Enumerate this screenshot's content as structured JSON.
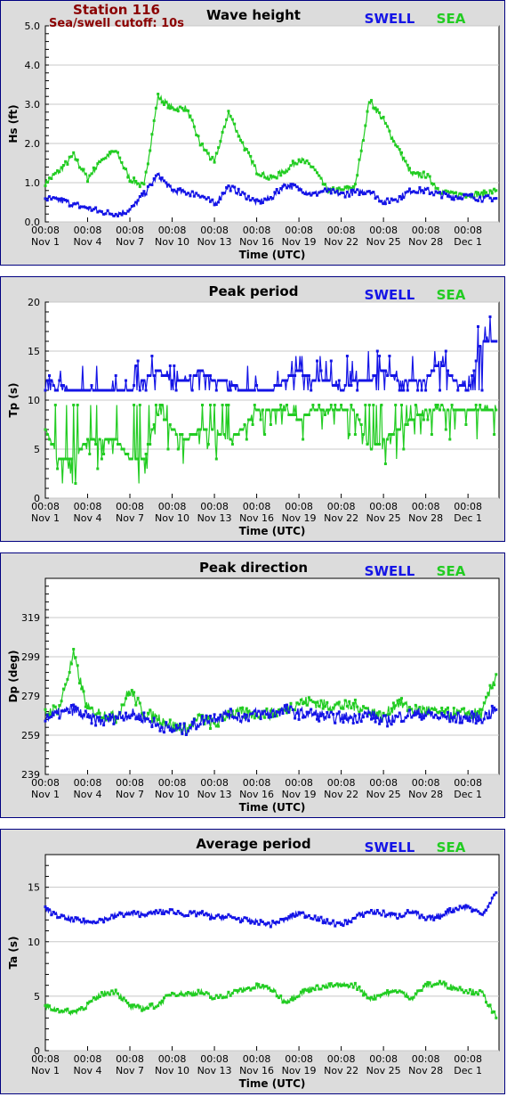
{
  "header": {
    "station": "Station 116",
    "cutoff": "Sea/swell cutoff: 10s"
  },
  "legend": {
    "swell": "SWELL",
    "sea": "SEA"
  },
  "colors": {
    "swell": "#1414e6",
    "sea": "#22cc22",
    "border": "#000080",
    "panel_bg": "#dcdcdc",
    "station_text": "#8b0000"
  },
  "xaxis": {
    "label": "Time (UTC)",
    "range": [
      0,
      32.2
    ],
    "ticks": [
      {
        "pos": 0,
        "time": "00:08",
        "date": "Nov 1"
      },
      {
        "pos": 3,
        "time": "00:08",
        "date": "Nov 4"
      },
      {
        "pos": 6,
        "time": "00:08",
        "date": "Nov 7"
      },
      {
        "pos": 9,
        "time": "00:08",
        "date": "Nov 10"
      },
      {
        "pos": 12,
        "time": "00:08",
        "date": "Nov 13"
      },
      {
        "pos": 15,
        "time": "00:08",
        "date": "Nov 16"
      },
      {
        "pos": 18,
        "time": "00:08",
        "date": "Nov 19"
      },
      {
        "pos": 21,
        "time": "00:08",
        "date": "Nov 22"
      },
      {
        "pos": 24,
        "time": "00:08",
        "date": "Nov 25"
      },
      {
        "pos": 27,
        "time": "00:08",
        "date": "Nov 28"
      },
      {
        "pos": 30,
        "time": "00:08",
        "date": "Dec 1"
      }
    ]
  },
  "chart_data": [
    {
      "type": "line",
      "title": "Wave height",
      "ylabel": "Hs (ft)",
      "ylim": [
        0,
        5
      ],
      "yticks": [
        "0.0",
        "1.0",
        "2.0",
        "3.0",
        "4.0",
        "5.0"
      ],
      "ytick_values": [
        0,
        1,
        2,
        3,
        4,
        5
      ],
      "x": [
        0,
        1,
        2,
        3,
        4,
        5,
        6,
        7,
        8,
        9,
        10,
        11,
        12,
        13,
        14,
        15,
        16,
        17,
        18,
        19,
        20,
        21,
        22,
        23,
        24,
        25,
        26,
        27,
        28,
        29,
        30,
        31,
        32
      ],
      "series": [
        {
          "name": "SWELL",
          "values": [
            0.6,
            0.55,
            0.45,
            0.35,
            0.25,
            0.2,
            0.3,
            0.7,
            1.2,
            0.8,
            0.75,
            0.7,
            0.45,
            0.9,
            0.7,
            0.5,
            0.6,
            0.95,
            0.85,
            0.7,
            0.8,
            0.7,
            0.75,
            0.8,
            0.5,
            0.6,
            0.8,
            0.8,
            0.7,
            0.65,
            0.65,
            0.6,
            0.6
          ]
        },
        {
          "name": "SEA",
          "values": [
            1.0,
            1.3,
            1.7,
            1.1,
            1.6,
            1.8,
            1.1,
            0.9,
            3.2,
            2.9,
            2.9,
            2.0,
            1.5,
            2.8,
            2.0,
            1.3,
            1.1,
            1.3,
            1.6,
            1.4,
            0.8,
            0.8,
            0.9,
            3.1,
            2.6,
            1.9,
            1.2,
            1.2,
            0.8,
            0.7,
            0.7,
            0.7,
            0.8
          ]
        }
      ]
    },
    {
      "type": "line",
      "title": "Peak period",
      "ylabel": "Tp (s)",
      "ylim": [
        0,
        20
      ],
      "yticks": [
        "0",
        "5",
        "10",
        "15",
        "20"
      ],
      "ytick_values": [
        0,
        5,
        10,
        15,
        20
      ],
      "x": [
        0,
        1,
        2,
        3,
        4,
        5,
        6,
        7,
        8,
        9,
        10,
        11,
        12,
        13,
        14,
        15,
        16,
        17,
        18,
        19,
        20,
        21,
        22,
        23,
        24,
        25,
        26,
        27,
        28,
        29,
        30,
        31,
        32
      ],
      "series": [
        {
          "name": "SWELL",
          "values": [
            12,
            11.5,
            11,
            11,
            11,
            11,
            11,
            12,
            13,
            12,
            12,
            13,
            12,
            12,
            11,
            11,
            11,
            12,
            13,
            12,
            12,
            11,
            12,
            12,
            13,
            12,
            12,
            12,
            14,
            12,
            11,
            16,
            16
          ]
        },
        {
          "name": "SEA",
          "values": [
            7,
            4,
            4,
            6,
            6,
            6,
            4,
            4,
            9,
            7,
            6,
            7,
            7,
            6,
            7,
            9,
            9,
            9,
            8,
            9,
            9,
            9,
            9,
            5,
            6,
            7,
            8,
            9,
            9,
            9,
            9,
            9,
            9
          ]
        }
      ]
    },
    {
      "type": "line",
      "title": "Peak direction",
      "ylabel": "Dp (deg)",
      "ylim": [
        239,
        339
      ],
      "yticks": [
        "239",
        "259",
        "279",
        "299",
        "319"
      ],
      "ytick_values": [
        239,
        259,
        279,
        299,
        319
      ],
      "x": [
        0,
        1,
        2,
        3,
        4,
        5,
        6,
        7,
        8,
        9,
        10,
        11,
        12,
        13,
        14,
        15,
        16,
        17,
        18,
        19,
        20,
        21,
        22,
        23,
        24,
        25,
        26,
        27,
        28,
        29,
        30,
        31,
        32
      ],
      "series": [
        {
          "name": "SWELL",
          "values": [
            268,
            270,
            272,
            268,
            266,
            268,
            270,
            268,
            264,
            262,
            262,
            266,
            268,
            270,
            268,
            270,
            270,
            272,
            270,
            270,
            268,
            268,
            268,
            270,
            266,
            268,
            270,
            270,
            268,
            268,
            268,
            268,
            272
          ]
        },
        {
          "name": "SEA",
          "values": [
            270,
            273,
            300,
            272,
            270,
            268,
            282,
            270,
            268,
            264,
            262,
            268,
            264,
            270,
            270,
            270,
            270,
            272,
            276,
            276,
            274,
            274,
            274,
            272,
            268,
            276,
            272,
            272,
            270,
            270,
            270,
            270,
            290
          ]
        }
      ]
    },
    {
      "type": "line",
      "title": "Average period",
      "ylabel": "Ta (s)",
      "ylim": [
        0,
        18
      ],
      "yticks": [
        "0",
        "5",
        "10",
        "15"
      ],
      "ytick_values": [
        0,
        5,
        10,
        15
      ],
      "x": [
        0,
        1,
        2,
        3,
        4,
        5,
        6,
        7,
        8,
        9,
        10,
        11,
        12,
        13,
        14,
        15,
        16,
        17,
        18,
        19,
        20,
        21,
        22,
        23,
        24,
        25,
        26,
        27,
        28,
        29,
        30,
        31,
        32
      ],
      "series": [
        {
          "name": "SWELL",
          "values": [
            13,
            12.3,
            12,
            11.8,
            12,
            12.4,
            12.6,
            12.5,
            12.7,
            12.8,
            12.5,
            12.6,
            12.2,
            12.3,
            12,
            11.8,
            11.6,
            12,
            12.6,
            12.3,
            11.8,
            11.6,
            12.2,
            12.8,
            12.6,
            12.3,
            12.8,
            12,
            12.4,
            13,
            13.2,
            12.5,
            14.5
          ]
        },
        {
          "name": "SEA",
          "values": [
            4,
            3.7,
            3.5,
            4.2,
            5.2,
            5.5,
            4,
            3.9,
            4.2,
            5.3,
            5.2,
            5.4,
            4.8,
            5.2,
            5.6,
            5.9,
            5.7,
            4.5,
            5.2,
            5.8,
            5.9,
            6,
            6,
            4.8,
            5.2,
            5.5,
            4.8,
            6,
            6.2,
            5.8,
            5.5,
            5.3,
            3
          ]
        }
      ]
    }
  ]
}
